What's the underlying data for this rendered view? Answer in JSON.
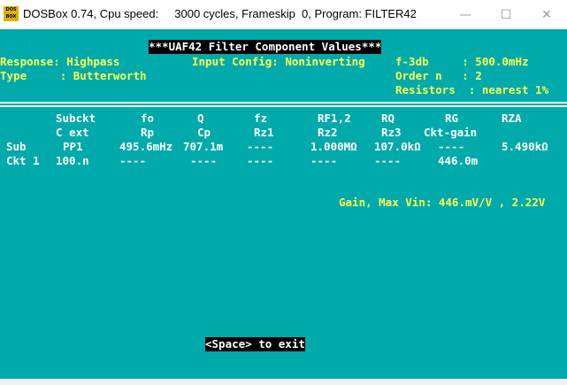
{
  "window": {
    "title": "DOSBox 0.74, Cpu speed:     3000 cycles, Frameskip  0, Program: FILTER42",
    "icon_label": "DOS BOX",
    "minimize_icon": "minimize-icon",
    "maximize_icon": "maximize-icon",
    "close_icon": "close-icon"
  },
  "screen": {
    "header": "***UAF42 Filter Component Values***",
    "response": "Response: Highpass",
    "input_config": "Input Config: Noninverting",
    "f3db": "f-3db     : 500.0mHz",
    "type": "Type     : Butterworth",
    "order": "Order n   : 2",
    "resistors": "Resistors  : nearest 1%",
    "table": {
      "header1": [
        "Subckt",
        "fo",
        "Q",
        "fz",
        "RF1,2",
        "RQ",
        "RG",
        "RZA"
      ],
      "header2": [
        "C ext",
        "Rp",
        "Cp",
        "Rz1",
        "Rz2",
        "Rz3",
        "Ckt-gain"
      ],
      "row_label1": "Sub",
      "row_label2": "Ckt 1",
      "row1": [
        "PP1",
        "495.6mHz",
        "707.1m",
        "----",
        "1.000MΩ",
        "107.0kΩ",
        "----",
        "5.490kΩ"
      ],
      "row2": [
        "100.n",
        "----",
        "----",
        "----",
        "----",
        "----",
        "446.0m"
      ]
    },
    "gain": "Gain, Max Vin: 446.mV/V , 2.22V",
    "footer": "<Space> to exit"
  }
}
